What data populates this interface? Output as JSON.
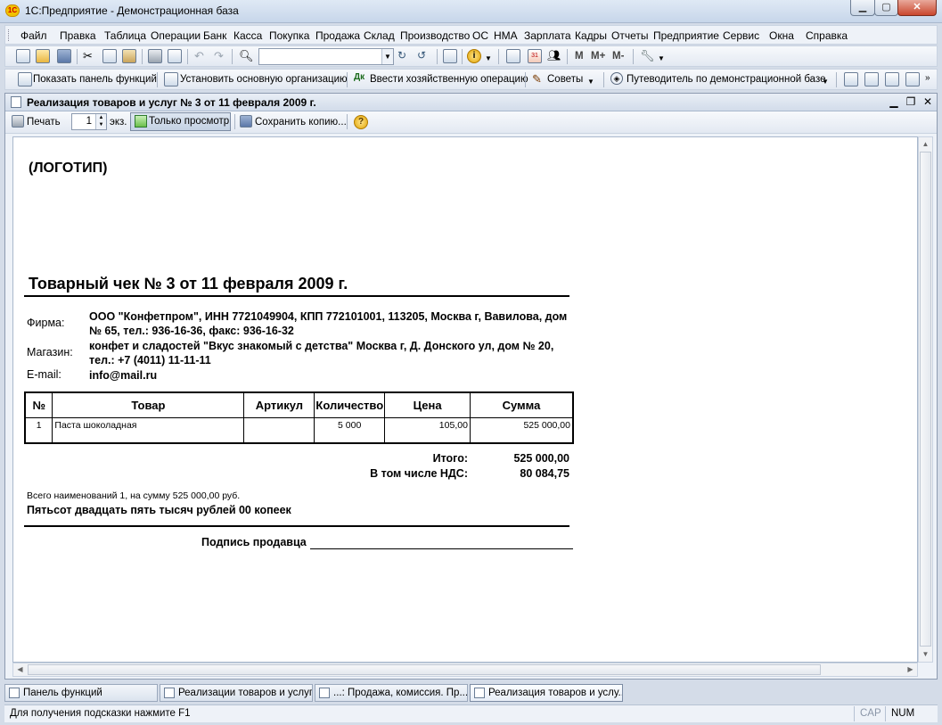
{
  "window": {
    "title": "1С:Предприятие - Демонстрационная база",
    "app_icon": "1С"
  },
  "menu": [
    "Файл",
    "Правка",
    "Таблица",
    "Операции",
    "Банк",
    "Касса",
    "Покупка",
    "Продажа",
    "Склад",
    "Производство",
    "ОС",
    "НМА",
    "Зарплата",
    "Кадры",
    "Отчеты",
    "Предприятие",
    "Сервис",
    "Окна",
    "Справка"
  ],
  "toolbar2": {
    "show_panel": "Показать панель функций",
    "set_org": "Установить основную организацию",
    "enter_op": "Ввести хозяйственную операцию",
    "tips": "Советы",
    "guide": "Путеводитель по демонстрационной базе"
  },
  "toolbar1": {
    "m": "M",
    "m_plus": "M+",
    "m_minus": "M-"
  },
  "document": {
    "title": "Реализация товаров и услуг № 3 от 11 февраля 2009 г.",
    "print": "Печать",
    "copies": "1",
    "copies_unit": "экз.",
    "view_only": "Только просмотр",
    "save_copy": "Сохранить копию..."
  },
  "report": {
    "logo": "(ЛОГОТИП)",
    "title": "Товарный чек № 3 от 11 февраля 2009 г.",
    "firm_label": "Фирма:",
    "firm_value": "ООО \"Конфетпром\", ИНН 7721049904, КПП 772101001, 113205, Москва г, Вавилова, дом № 65, тел.: 936-16-36, факс: 936-16-32",
    "shop_label": "Магазин:",
    "shop_value": "конфет и сладостей \"Вкус знакомый с детства\" Москва г, Д. Донского ул, дом № 20, тел.: +7 (4011) 11-11-11",
    "email_label": "E-mail:",
    "email_value": "info@mail.ru",
    "table": {
      "headers": [
        "№",
        "Товар",
        "Артикул",
        "Количество",
        "Цена",
        "Сумма"
      ],
      "rows": [
        [
          "1",
          "Паста шоколадная",
          "",
          "5 000",
          "105,00",
          "525 000,00"
        ]
      ]
    },
    "total_label": "Итого:",
    "total_value": "525 000,00",
    "vat_label": "В том числе НДС:",
    "vat_value": "80 084,75",
    "summary": "Всего наименований 1, на сумму 525 000,00 руб.",
    "words": "Пятьсот двадцать пять тысяч рублей 00 копеек",
    "signature": "Подпись продавца"
  },
  "tasks": [
    "Панель функций",
    "Реализации товаров и услуг",
    "...: Продажа, комиссия. Пр...",
    "Реализация товаров и услу..."
  ],
  "status": {
    "hint": "Для получения подсказки нажмите F1",
    "cap": "CAP",
    "num": "NUM"
  }
}
